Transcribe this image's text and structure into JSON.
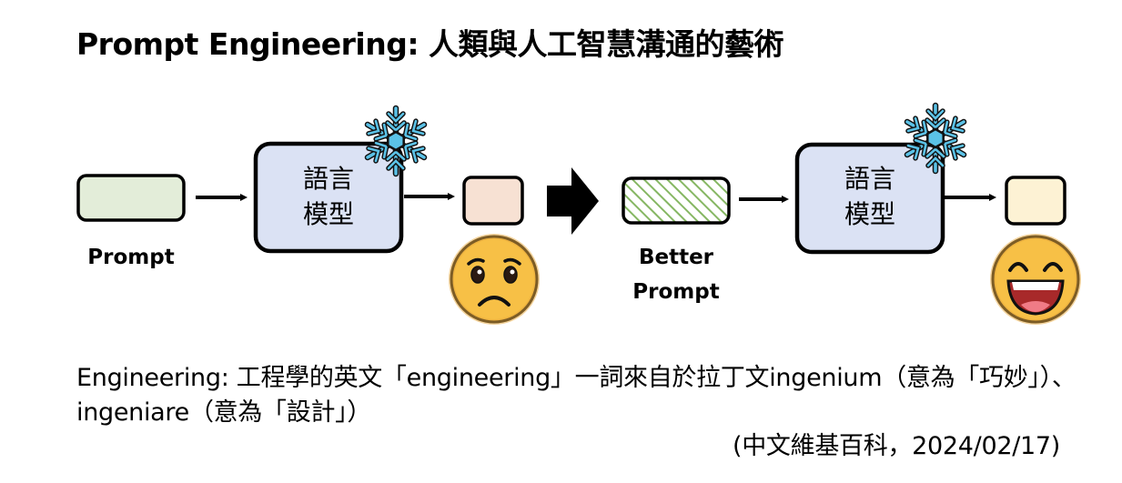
{
  "title": "Prompt Engineering: 人類與人工智慧溝通的藝術",
  "left_stage": {
    "input_label": "Prompt",
    "model_label_line1": "語言",
    "model_label_line2": "模型",
    "face": "sad-face"
  },
  "right_stage": {
    "input_label_line1": "Better",
    "input_label_line2": "Prompt",
    "model_label_line1": "語言",
    "model_label_line2": "模型",
    "face": "laughing-face"
  },
  "frozen_icon": "snowflake-icon",
  "colors": {
    "prompt_box": "#e3edd9",
    "model_box": "#dbe2f4",
    "output_sad": "#f7e1d3",
    "output_happy": "#fdf2d4",
    "hatch": "#86b763",
    "snowflake": "#5bc2e7",
    "face": "#f7c046"
  },
  "description": "Engineering: 工程學的英文「engineering」一詞來自於拉丁文ingenium（意為「巧妙」）、ingeniare（意為「設計」）",
  "citation": "(中文維基百科，2024/02/17)"
}
